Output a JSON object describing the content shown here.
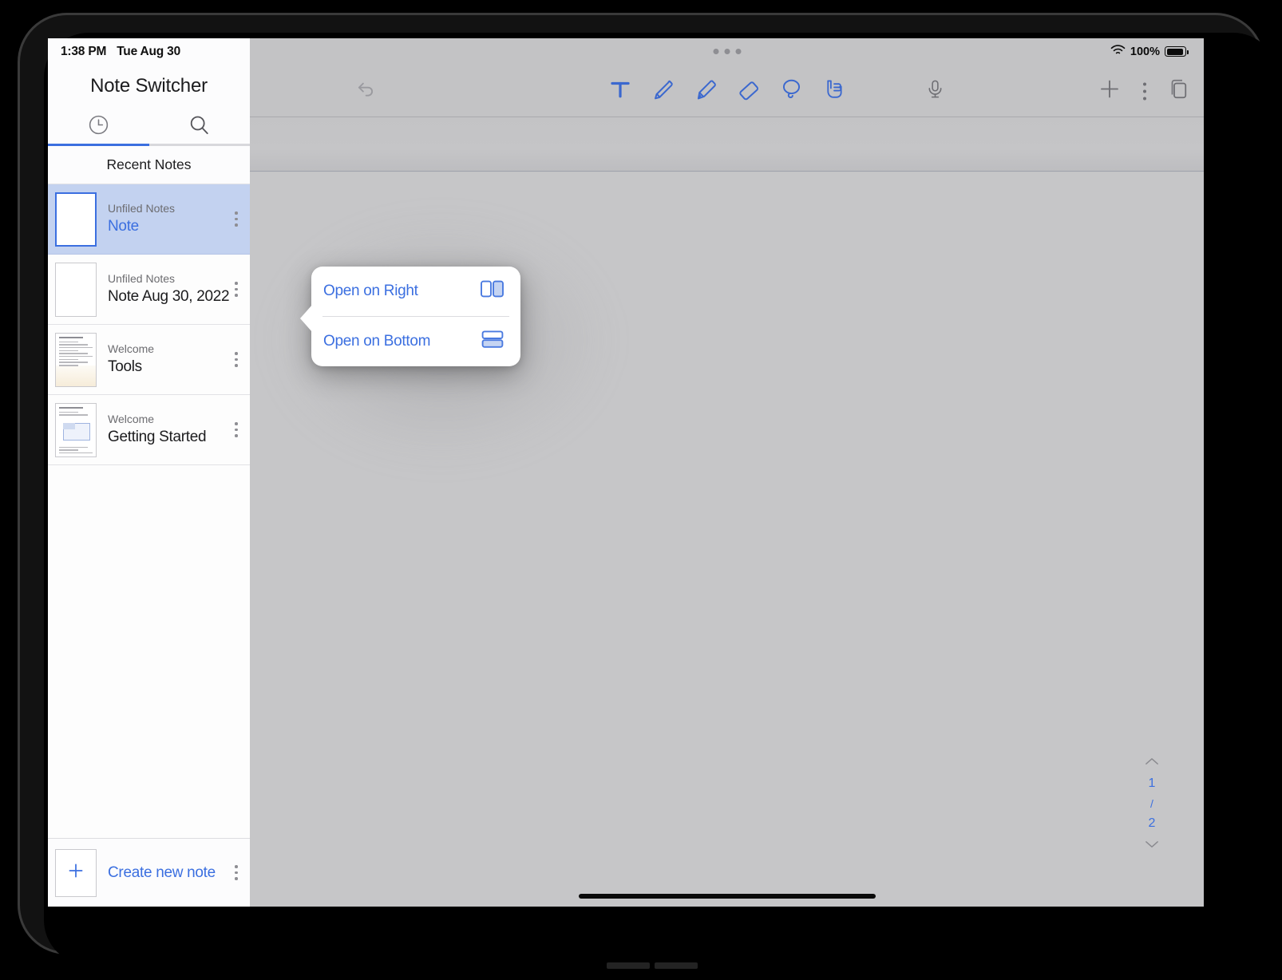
{
  "device": {
    "kind": "tablet-bezel"
  },
  "status_bar": {
    "time": "1:38 PM",
    "date": "Tue Aug 30",
    "battery_percent": "100%",
    "wifi_icon": "wifi-icon",
    "battery_icon": "battery-full-icon",
    "multitask_handle_icon": "multitask-handle-dots-icon"
  },
  "sidebar": {
    "title": "Note Switcher",
    "tabs": [
      {
        "name": "recent",
        "icon": "clock-icon",
        "active": true
      },
      {
        "name": "search",
        "icon": "search-icon",
        "active": false
      }
    ],
    "section_header": "Recent Notes",
    "notes": [
      {
        "folder": "Unfiled Notes",
        "title": "Note",
        "selected": true,
        "thumb": "blank",
        "menu_icon": "kebab-menu-icon"
      },
      {
        "folder": "Unfiled Notes",
        "title": "Note Aug 30, 2022",
        "selected": false,
        "thumb": "blank",
        "menu_icon": "kebab-menu-icon"
      },
      {
        "folder": "Welcome",
        "title": "Tools",
        "selected": false,
        "thumb": "document-preview",
        "menu_icon": "kebab-menu-icon"
      },
      {
        "folder": "Welcome",
        "title": "Getting Started",
        "selected": false,
        "thumb": "document-preview",
        "menu_icon": "kebab-menu-icon"
      }
    ],
    "create": {
      "label": "Create new note",
      "plus_icon": "plus-icon",
      "menu_icon": "kebab-menu-icon"
    }
  },
  "toolbar": {
    "undo": {
      "label": "",
      "icon": "undo-arrow-icon",
      "enabled": false
    },
    "tools": [
      {
        "name": "text",
        "icon": "text-tool-icon",
        "active": true
      },
      {
        "name": "pen",
        "icon": "pen-icon",
        "active": false
      },
      {
        "name": "highlighter",
        "icon": "highlighter-icon",
        "active": false
      },
      {
        "name": "eraser",
        "icon": "eraser-icon",
        "active": false
      },
      {
        "name": "lasso",
        "icon": "lasso-icon",
        "active": false
      },
      {
        "name": "hand",
        "icon": "hand-icon",
        "active": false
      }
    ],
    "microphone": {
      "icon": "microphone-icon"
    },
    "add": {
      "icon": "plus-icon"
    },
    "more": {
      "icon": "kebab-menu-icon"
    },
    "pages": {
      "icon": "stacked-pages-icon"
    }
  },
  "popup": {
    "items": [
      {
        "label": "Open on Right",
        "icon": "split-right-icon"
      },
      {
        "label": "Open on Bottom",
        "icon": "split-bottom-icon"
      }
    ]
  },
  "pager": {
    "current_page": "1",
    "separator": "/",
    "total_pages": "2",
    "up_icon": "chevron-up-icon",
    "down_icon": "chevron-down-icon"
  },
  "colors": {
    "accent_blue": "#3b6fe0",
    "selected_row": "#c3d2f0",
    "canvas_gray": "#c6c6c8",
    "sidebar_white": "#fcfcfd"
  }
}
